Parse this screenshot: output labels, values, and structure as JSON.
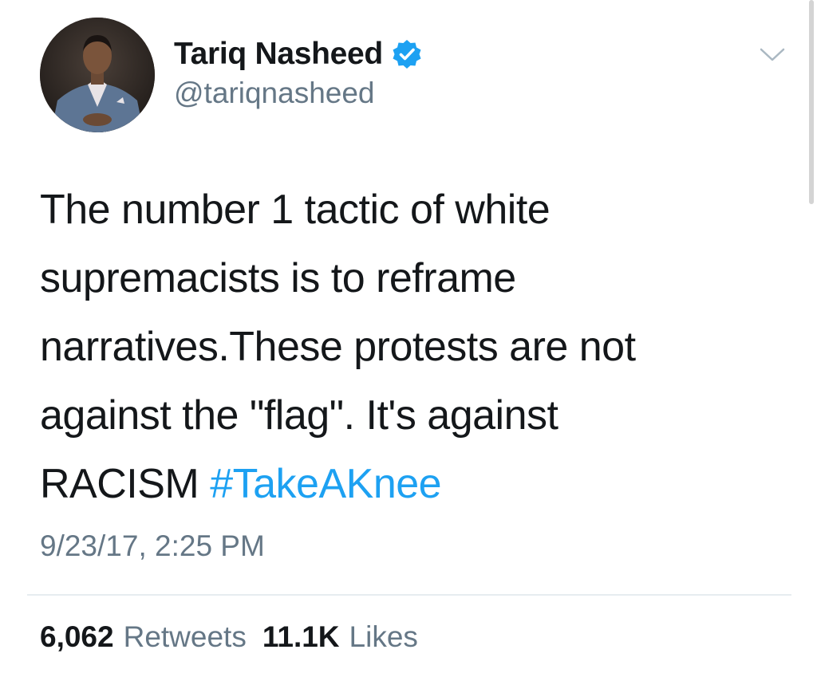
{
  "author": {
    "name": "Tariq Nasheed",
    "handle": "@tariqnasheed",
    "verified": true,
    "avatar_icon": "profile-photo"
  },
  "tweet": {
    "lines": [
      "The number 1 tactic of white",
      "supremacists is to reframe",
      "narratives.These protests are not",
      "against the \"flag\". It's against"
    ],
    "last_line_text": "RACISM ",
    "hashtag": "#TakeAKnee",
    "timestamp": "9/23/17, 2:25 PM"
  },
  "stats": {
    "retweets_count": "6,062",
    "retweets_label": "Retweets",
    "likes_count": "11.1K",
    "likes_label": "Likes"
  },
  "colors": {
    "text": "#14171a",
    "secondary": "#657786",
    "accent": "#1da1f2",
    "divider": "#e6ecf0"
  },
  "icons": {
    "menu": "chevron-down-icon",
    "verified": "verified-badge-icon"
  }
}
